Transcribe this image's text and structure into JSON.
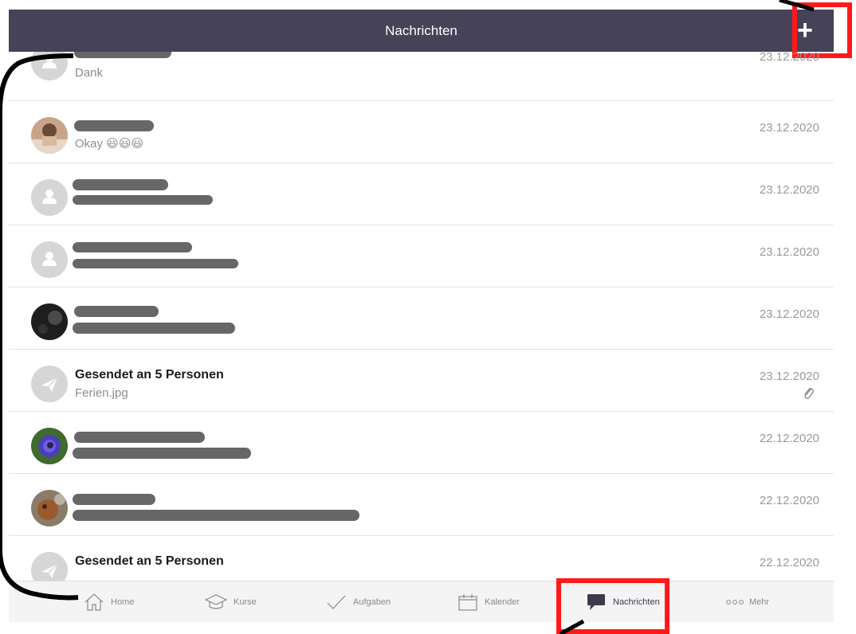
{
  "header": {
    "title": "Nachrichten",
    "add_label": "+"
  },
  "messages": [
    {
      "name": "",
      "preview": "Dank",
      "date": "23.12.2020",
      "avatar": "person-placeholder-icon"
    },
    {
      "name": "",
      "preview": "Okay 😃😃😃",
      "date": "23.12.2020",
      "avatar": "photo-avatar-child"
    },
    {
      "name": "",
      "preview": "",
      "date": "23.12.2020",
      "avatar": "person-placeholder-icon"
    },
    {
      "name": "",
      "preview": "",
      "date": "23.12.2020",
      "avatar": "person-placeholder-icon"
    },
    {
      "name": "",
      "preview": "",
      "date": "23.12.2020",
      "avatar": "photo-avatar-dark"
    },
    {
      "name": "Gesendet an 5 Personen",
      "preview": "Ferien.jpg",
      "date": "23.12.2020",
      "avatar": "send-icon",
      "attachment": "paperclip-icon"
    },
    {
      "name": "",
      "preview": "",
      "date": "22.12.2020",
      "avatar": "photo-avatar-flower"
    },
    {
      "name": "",
      "preview": "",
      "date": "22.12.2020",
      "avatar": "photo-avatar-animal"
    },
    {
      "name": "Gesendet an 5 Personen",
      "preview": "",
      "date": "22.12.2020",
      "avatar": "send-icon"
    }
  ],
  "nav": [
    {
      "label": "Home",
      "icon": "home-icon"
    },
    {
      "label": "Kurse",
      "icon": "graduation-cap-icon"
    },
    {
      "label": "Aufgaben",
      "icon": "checkmark-icon"
    },
    {
      "label": "Kalender",
      "icon": "calendar-icon"
    },
    {
      "label": "Nachrichten",
      "icon": "chat-bubble-icon",
      "active": true
    },
    {
      "label": "Mehr",
      "icon": "more-dots-icon"
    }
  ],
  "colors": {
    "header_bg": "#464258",
    "annotation_red": "#ff1a1a",
    "nav_bg": "#f4f4f4"
  }
}
